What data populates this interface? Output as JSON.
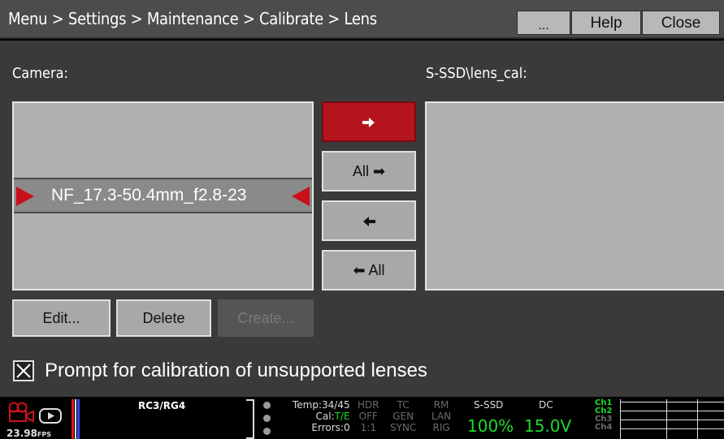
{
  "header": {
    "breadcrumb": "Menu > Settings > Maintenance > Calibrate > Lens",
    "more_label": "...",
    "help_label": "Help",
    "close_label": "Close"
  },
  "camera_panel": {
    "label": "Camera:",
    "items": [
      "NF_17.3-50.4mm_f2.8-23"
    ],
    "selected_item": "NF_17.3-50.4mm_f2.8-23"
  },
  "media_panel": {
    "label": "S-SSD\\lens_cal:",
    "items": []
  },
  "transfer_buttons": {
    "copy_right_label": "→",
    "copy_all_right_label": "All ➡",
    "copy_left_label": "←",
    "copy_all_left_label": "⬅ All"
  },
  "actions": {
    "edit_label": "Edit...",
    "delete_label": "Delete",
    "create_label": "Create..."
  },
  "prompt_option": {
    "label": "Prompt for calibration of unsupported lenses",
    "checked": true
  },
  "status_bar": {
    "fps_value": "23.98",
    "fps_unit": "FPS",
    "codec": "RC3/RG4",
    "temp": "Temp:34/45",
    "cal_label": "Cal:",
    "cal_value": "T/E",
    "errors": "Errors:0",
    "cols": [
      {
        "top": "HDR",
        "mid": "OFF",
        "bot": "1:1"
      },
      {
        "top": "TC",
        "mid": "GEN",
        "bot": "SYNC"
      },
      {
        "top": "RM",
        "mid": "LAN",
        "bot": "RIG"
      }
    ],
    "media_label": "S-SSD",
    "media_value": "100%",
    "power_label": "DC",
    "power_value": "15.0V",
    "channels": [
      "Ch1",
      "Ch2",
      "Ch3",
      "Ch4"
    ],
    "accent_green": "#1edc28",
    "accent_red": "#c8101a"
  }
}
